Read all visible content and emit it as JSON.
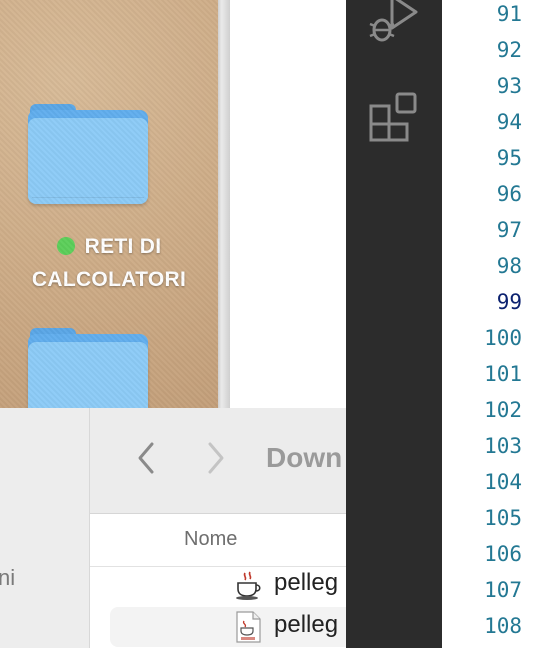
{
  "desktop": {
    "folders": [
      {
        "label_line1": "RETI DI",
        "label_line2": "CALCOLATORI",
        "tag_color": "#5ccf5a"
      }
    ]
  },
  "finder": {
    "sidebar_partial_text": "ni",
    "toolbar": {
      "back_icon": "chevron-left-icon",
      "forward_icon": "chevron-right-icon",
      "title": "Down"
    },
    "columns": {
      "name": "Nome"
    },
    "files": [
      {
        "name": "pelleg",
        "icon": "java-coffee-icon"
      },
      {
        "name": "pelleg",
        "icon": "java-file-icon"
      }
    ]
  },
  "vscode": {
    "activity_icons": [
      "run-debug-icon",
      "extensions-icon"
    ],
    "line_numbers": [
      "91",
      "92",
      "93",
      "94",
      "95",
      "96",
      "97",
      "98",
      "99",
      "100",
      "101",
      "102",
      "103",
      "104",
      "105",
      "106",
      "107",
      "108"
    ],
    "active_line": "99",
    "colors": {
      "line_number": "#237893",
      "active_line_number": "#0b216f",
      "activity_bar": "#2c2c2c"
    }
  }
}
